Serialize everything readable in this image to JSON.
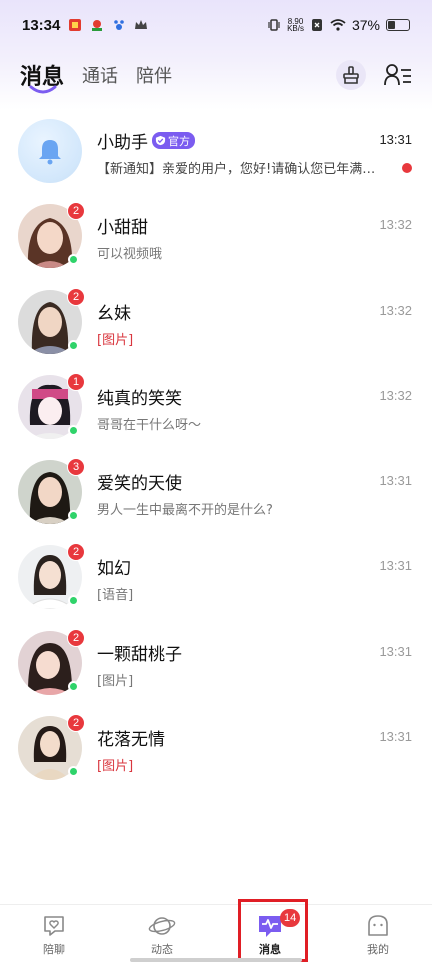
{
  "status_bar": {
    "time": "13:34",
    "net_speed_value": "8.90",
    "net_speed_unit": "KB/s",
    "battery": "37%",
    "battery_level": 0.37
  },
  "header": {
    "tabs": [
      {
        "label": "消息",
        "active": true
      },
      {
        "label": "通话",
        "active": false
      },
      {
        "label": "陪伴",
        "active": false
      }
    ],
    "actions": [
      "broom-icon",
      "contacts-icon"
    ]
  },
  "conversations": [
    {
      "name": "小助手",
      "official_label": "官方",
      "time": "13:31",
      "message": "【新通知】亲爱的用户，您好!请确认您已年满…",
      "badge": "",
      "online": false,
      "unread_dot": true
    },
    {
      "name": "小甜甜",
      "time": "13:32",
      "message": "可以视频哦",
      "badge": "2",
      "online": true
    },
    {
      "name": "幺妹",
      "time": "13:32",
      "message": "[图片]",
      "badge": "2",
      "online": true
    },
    {
      "name": "纯真的笑笑",
      "time": "13:32",
      "message": "哥哥在干什么呀～",
      "badge": "1",
      "online": true
    },
    {
      "name": "爱笑的天使",
      "time": "13:31",
      "message": "男人一生中最离不开的是什么?",
      "badge": "3",
      "online": true
    },
    {
      "name": "如幻",
      "time": "13:31",
      "message": "[语音]",
      "badge": "2",
      "online": true
    },
    {
      "name": "一颗甜桃子",
      "time": "13:31",
      "message": "[图片]",
      "badge": "2",
      "online": true
    },
    {
      "name": "花落无情",
      "time": "13:31",
      "message": "[图片]",
      "badge": "2",
      "online": true
    }
  ],
  "bottom_nav": {
    "items": [
      {
        "label": "陪聊",
        "icon": "heart-chat-icon"
      },
      {
        "label": "动态",
        "icon": "planet-icon"
      },
      {
        "label": "消息",
        "icon": "message-pulse-icon",
        "badge": "14",
        "active": true
      },
      {
        "label": "我的",
        "icon": "profile-icon"
      }
    ]
  },
  "colors": {
    "accent": "#7b5cf0",
    "badge_red": "#e8383d",
    "online_green": "#2fd36a",
    "highlight_red": "#e01e25"
  }
}
